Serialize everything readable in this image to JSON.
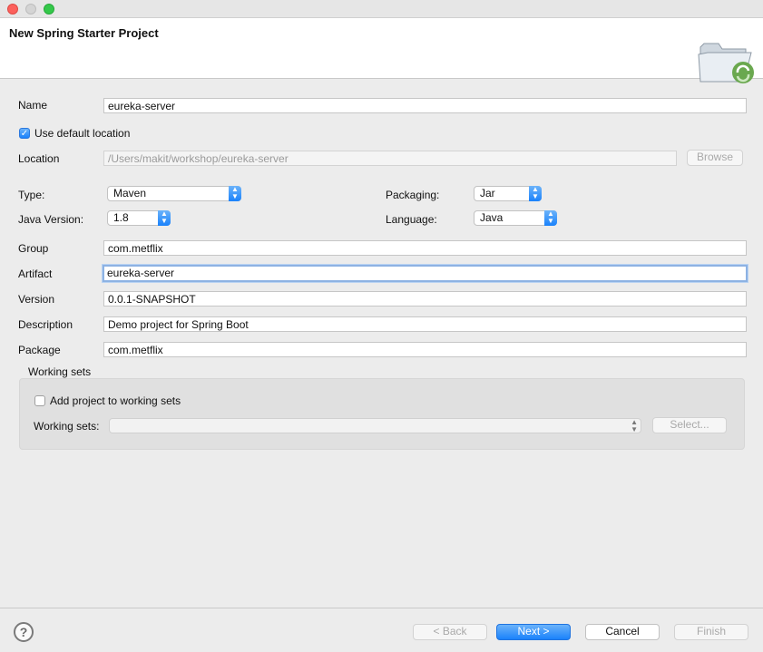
{
  "window": {
    "title_bar_buttons": [
      "close",
      "minimize",
      "zoom"
    ]
  },
  "header": {
    "title": "New Spring Starter Project",
    "icon": "folder-spring-icon"
  },
  "form": {
    "name": {
      "label": "Name",
      "value": "eureka-server"
    },
    "use_default_location": {
      "label": "Use default location",
      "checked": true
    },
    "location": {
      "label": "Location",
      "value": "/Users/makit/workshop/eureka-server",
      "browse_label": "Browse"
    },
    "type": {
      "label": "Type:",
      "value": "Maven"
    },
    "packaging": {
      "label": "Packaging:",
      "value": "Jar"
    },
    "java_version": {
      "label": "Java Version:",
      "value": "1.8"
    },
    "language": {
      "label": "Language:",
      "value": "Java"
    },
    "group": {
      "label": "Group",
      "value": "com.metflix"
    },
    "artifact": {
      "label": "Artifact",
      "value": "eureka-server"
    },
    "version": {
      "label": "Version",
      "value": "0.0.1-SNAPSHOT"
    },
    "description": {
      "label": "Description",
      "value": "Demo project for Spring Boot"
    },
    "package": {
      "label": "Package",
      "value": "com.metflix"
    }
  },
  "working_sets": {
    "title": "Working sets",
    "add_label": "Add project to working sets",
    "add_checked": false,
    "sets_label": "Working sets:",
    "sets_value": "",
    "select_label": "Select..."
  },
  "footer": {
    "help": "?",
    "back_label": "< Back",
    "next_label": "Next >",
    "cancel_label": "Cancel",
    "finish_label": "Finish"
  },
  "colors": {
    "accent": "#1a82fb",
    "focus_ring": "#8db2e3"
  }
}
